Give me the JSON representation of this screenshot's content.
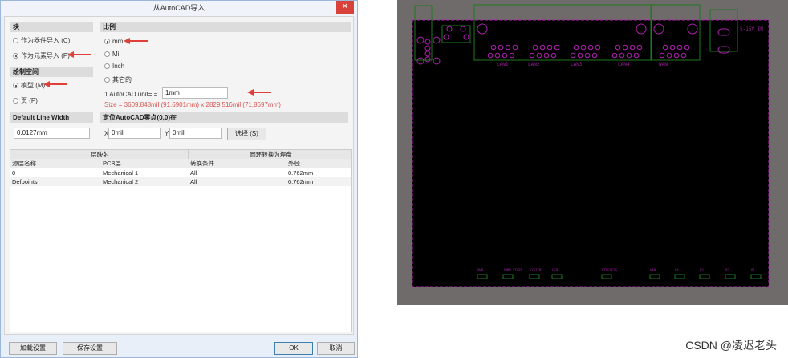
{
  "dialog": {
    "title": "从AutoCAD导入",
    "close": "✕",
    "block": {
      "header": "块",
      "opt1": "作为器件导入 (C)",
      "opt2": "作为元素导入 (P)"
    },
    "space": {
      "header": "绘制空间",
      "opt1": "模型 (M)",
      "opt2": "页 (P)"
    },
    "scale": {
      "header": "比例",
      "opts": [
        "mm",
        "Mil",
        "Inch",
        "其它的"
      ],
      "unit_label": "1 AutoCAD unit= =",
      "unit_value": "1mm",
      "size": "Size = 3609.848mil (91.6901mm) x 2829.516mil (71.8697mm)"
    },
    "line_width": {
      "header": "Default Line Width",
      "value": "0.0127mm"
    },
    "origin": {
      "header": "定位AutoCAD零点(0,0)在",
      "x_label": "X",
      "x_value": "0mil",
      "y_label": "Y",
      "y_value": "0mil",
      "select": "选择 (S)"
    },
    "table": {
      "group1": "层映射",
      "group2": "圆环转换为焊盘",
      "cols": [
        "源层名称",
        "PCB层",
        "转换条件",
        "外径"
      ],
      "rows": [
        [
          "0",
          "Mechanical 1",
          "All",
          "0.762mm"
        ],
        [
          "Defpoints",
          "Mechanical 2",
          "All",
          "0.762mm"
        ]
      ]
    },
    "buttons": {
      "load": "加载设置",
      "save": "保存设置",
      "ok": "OK",
      "cancel": "取消"
    }
  },
  "pcb": {
    "power_label": "5-15V IN",
    "lan_labels": [
      "LAN1",
      "LAN2",
      "LAN3",
      "LAN4",
      "WAN"
    ],
    "led_labels": [
      "PWR",
      "JUMP START",
      "SYSTEM",
      "USB",
      "WIRELESS",
      "WAN",
      "P4",
      "P3",
      "P2",
      "P1"
    ]
  },
  "watermark": "CSDN @凌迟老头",
  "colors": {
    "accent_arrow": "#e0403a",
    "pcb_outline": "#b01fb0",
    "pcb_green": "#1f7a1f"
  }
}
